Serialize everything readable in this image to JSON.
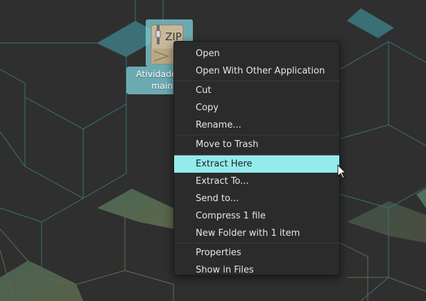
{
  "desktop_icon": {
    "badge": "ZIP",
    "label_line1": "Atividade",
    "label_line2": "main.",
    "icon": "zip-archive-icon"
  },
  "context_menu": {
    "groups": [
      [
        {
          "label": "Open"
        },
        {
          "label": "Open With Other Application"
        }
      ],
      [
        {
          "label": "Cut"
        },
        {
          "label": "Copy"
        },
        {
          "label": "Rename..."
        }
      ],
      [
        {
          "label": "Move to Trash"
        }
      ],
      [
        {
          "label": "Extract Here",
          "highlighted": true
        },
        {
          "label": "Extract To..."
        },
        {
          "label": "Send to..."
        },
        {
          "label": "Compress 1 file"
        },
        {
          "label": "New Folder with 1 item"
        }
      ],
      [
        {
          "label": "Properties"
        },
        {
          "label": "Show in Files"
        }
      ]
    ]
  },
  "colors": {
    "highlight": "#93ebee",
    "menu_background": "#2b2b2b",
    "desktop_background": "#2f2f2f",
    "icon_selection": "#7dcdd7"
  }
}
